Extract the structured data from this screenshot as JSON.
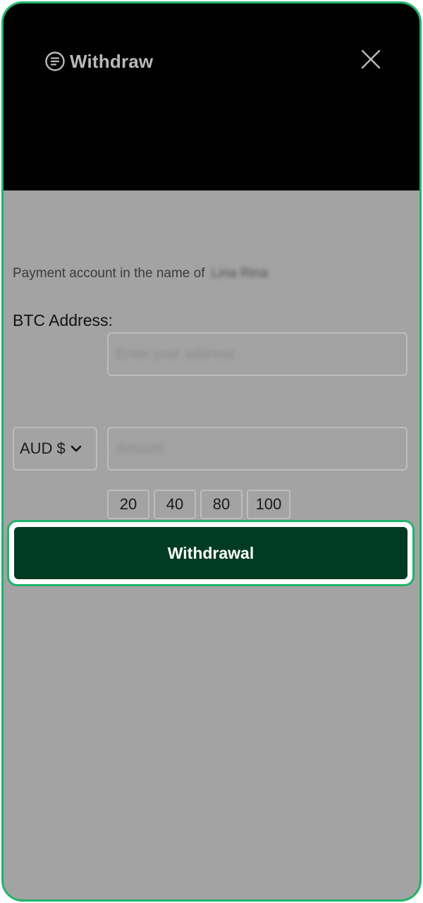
{
  "header": {
    "title": "Withdraw",
    "title_icon": "document-icon",
    "close_icon": "close-icon"
  },
  "account": {
    "owner_prefix": "Payment account in the name of",
    "owner_name": "Lina Rina"
  },
  "form": {
    "address_label": "BTC Address:",
    "address_placeholder": "Enter your address",
    "currency_selected": "AUD $",
    "amount_placeholder": "Amount",
    "quick_amounts": [
      "20",
      "40",
      "80",
      "100"
    ]
  },
  "actions": {
    "withdraw_label": "Withdrawal"
  },
  "colors": {
    "accent": "#1fb46b",
    "button": "#013b23",
    "overlay": "#a3a3a3",
    "header": "#000000"
  }
}
